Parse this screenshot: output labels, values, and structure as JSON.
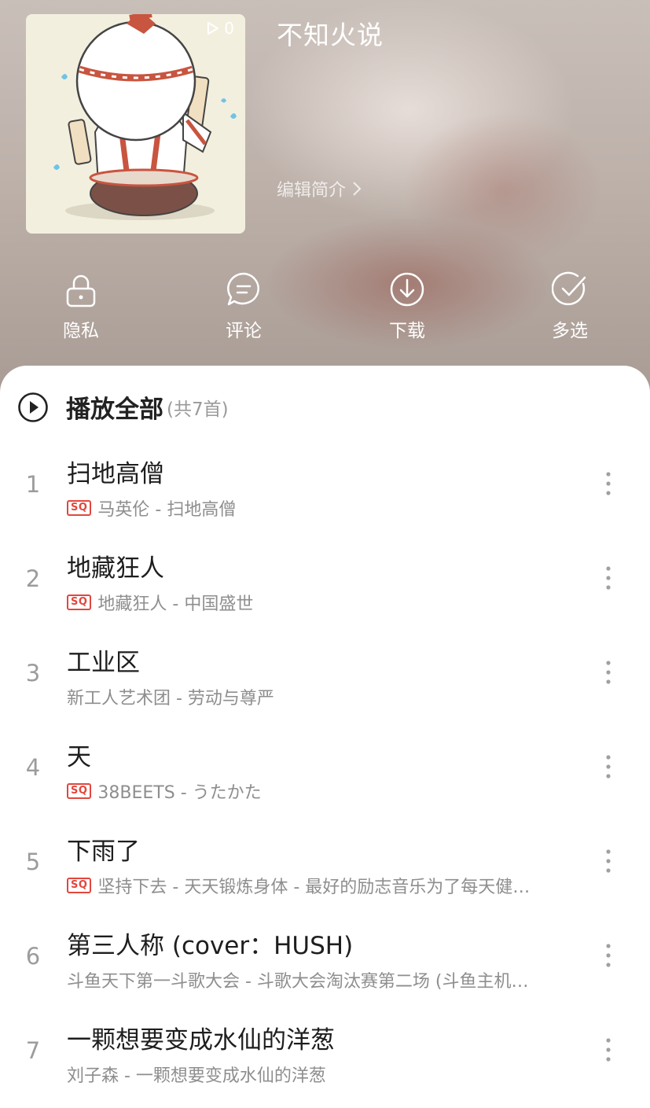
{
  "header": {
    "playlist_title": "不知火说",
    "play_count": "0",
    "edit_intro": "编辑简介",
    "icons": {
      "play_count": "play-triangle-icon",
      "edit_intro": "chevron-right-icon"
    }
  },
  "actions": [
    {
      "label": "隐私",
      "icon": "lock-icon"
    },
    {
      "label": "评论",
      "icon": "comment-icon"
    },
    {
      "label": "下载",
      "icon": "download-icon"
    },
    {
      "label": "多选",
      "icon": "multiselect-check-icon"
    }
  ],
  "play_all": {
    "label": "播放全部",
    "count": "(共7首)",
    "icon": "play-circle-icon"
  },
  "tracks": [
    {
      "num": "1",
      "title": "扫地高僧",
      "sq": true,
      "subtitle": "马英伦 - 扫地高僧"
    },
    {
      "num": "2",
      "title": "地藏狂人",
      "sq": true,
      "subtitle": "地藏狂人 - 中国盛世"
    },
    {
      "num": "3",
      "title": "工业区",
      "sq": false,
      "subtitle": "新工人艺术团 - 劳动与尊严"
    },
    {
      "num": "4",
      "title": "天",
      "sq": true,
      "subtitle": "38BEETS - うたかた"
    },
    {
      "num": "5",
      "title": "下雨了",
      "sq": true,
      "subtitle": "坚持下去 - 天天锻炼身体 - 最好的励志音乐为了每天健…"
    },
    {
      "num": "6",
      "title": "第三人称 (cover：HUSH)",
      "sq": false,
      "subtitle": "斗鱼天下第一斗歌大会 - 斗歌大会淘汰赛第二场 (斗鱼主机…"
    },
    {
      "num": "7",
      "title": "一颗想要变成水仙的洋葱",
      "sq": false,
      "subtitle": "刘子森 - 一颗想要变成水仙的洋葱"
    }
  ],
  "sq_badge": "SQ",
  "colors": {
    "sq_red": "#e2473e",
    "title_text": "#1e1e1e",
    "secondary_text": "#8e8e8e"
  }
}
